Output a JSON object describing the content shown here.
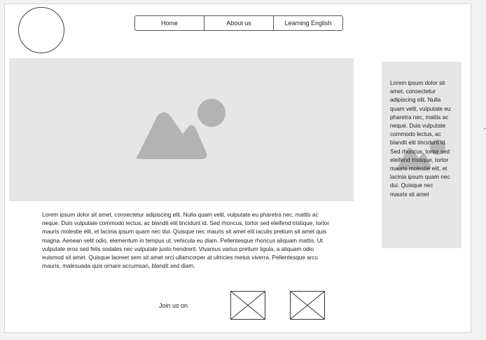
{
  "nav": {
    "items": [
      {
        "label": "Home"
      },
      {
        "label": "About us"
      },
      {
        "label": "Learning English"
      }
    ]
  },
  "hero": {
    "icon": "image-placeholder-icon"
  },
  "main": {
    "paragraph": "Lorem ipsum dolor sit amet, consectetur adipiscing elit. Nulla quam velit, vulputate eu pharetra nec, mattis ac neque. Duis vulputate commodo lectus, ac blandit elit tincidunt id. Sed rhoncus, tortor sed eleifend tristique, tortor mauris molestie elit, et lacinia ipsum quam nec dui. Quisque nec mauris sit amet elit iaculis pretium sit amet quis magna. Aenean velit odio, elementum in tempus ut, vehicula eu diam. Pellentesque rhoncus aliquam mattis. Ut vulputate eros sed felis sodales nec vulputate justo hendrerit. Vivamus varius pretium ligula, a aliquam odio euismod sit amet. Quisque laoreet sem sit amet orci ullamcorper at ultricies metus viverra. Pellentesque arcu mauris, malesuada quis ornare accumsan, blandit sed diam."
  },
  "sidebar": {
    "text": "Lorem ipsum dolor sit amet, consectetur adipiscing elit. Nulla quam velit, vulputate eu pharetra nec, mattis ac neque. Duis vulputate commodo lectus, ac blandit elit tincidunt id. Sed rhoncus, tortor sed eleifend tristique, tortor mauris molestie elit, et lacinia ipsum quam nec dui. Quisque nec mauris sit amet",
    "icon": "image-placeholder-icon"
  },
  "footer": {
    "join_label": "Join us on",
    "social_icons": [
      "social-placeholder-icon",
      "social-placeholder-icon"
    ]
  },
  "colors": {
    "placeholder_fill": "#e6e6e6",
    "placeholder_shape": "#b3b3b3",
    "border": "#555555"
  }
}
